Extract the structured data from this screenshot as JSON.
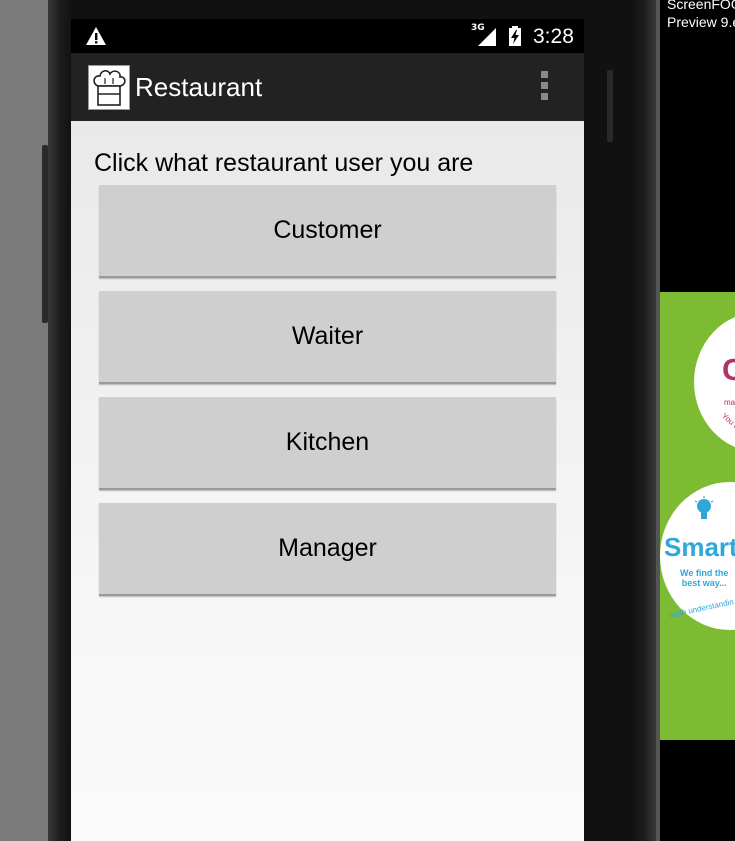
{
  "status_bar": {
    "network_label": "3G",
    "time": "3:28",
    "icons": [
      "warning-icon",
      "signal-icon",
      "battery-charging-icon"
    ]
  },
  "action_bar": {
    "title": "Restaurant",
    "icon": "chef-hat-icon",
    "overflow_icon": "overflow-menu-icon"
  },
  "main": {
    "prompt": "Click what restaurant user you are",
    "buttons": [
      {
        "label": "Customer"
      },
      {
        "label": "Waiter"
      },
      {
        "label": "Kitchen"
      },
      {
        "label": "Manager"
      }
    ]
  },
  "background_window": {
    "filename_line1": "ScreenFOG",
    "filename_line2": "Preview 9.e",
    "ad_letter": "C",
    "ad_small_text": "mal",
    "ad_arc_text_1": "You ca",
    "ad_heading": "Smart",
    "ad_tagline_1": "We find the",
    "ad_tagline_2": "best way...",
    "ad_arc_text_2": "ough understandin",
    "colors": {
      "ad_green": "#7cbb32",
      "ad_pink": "#b0336a",
      "ad_blue": "#2fa8d8"
    }
  }
}
